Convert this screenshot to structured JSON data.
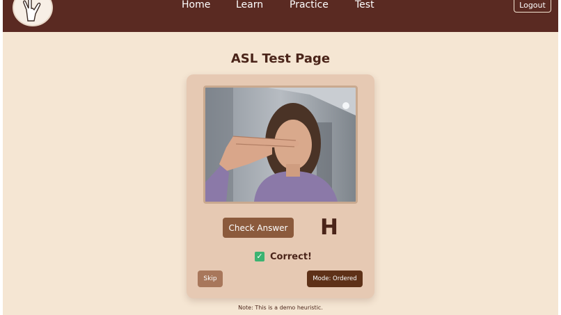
{
  "nav": {
    "logo_icon": "asl-love-hand-logo-icon",
    "links": [
      "Home",
      "Learn",
      "Practice",
      "Test"
    ],
    "logout_label": "Logout"
  },
  "main": {
    "title": "ASL Test Page"
  },
  "card": {
    "camera_feed_icon": "webcam-feed",
    "check_button_label": "Check Answer",
    "target_letter": "H",
    "result_icon": "checkbox-check-icon",
    "result_text": "Correct!",
    "skip_label": "Skip",
    "mode_label": "Mode: Ordered"
  },
  "footer": {
    "note": "Note: This is a demo heuristic."
  },
  "colors": {
    "navbar": "#5a2a22",
    "background": "#f5e6d3",
    "card": "#e6c9b3",
    "primary_button": "#8b5a3c",
    "mode_button": "#5e3118",
    "success": "#3cb371"
  }
}
